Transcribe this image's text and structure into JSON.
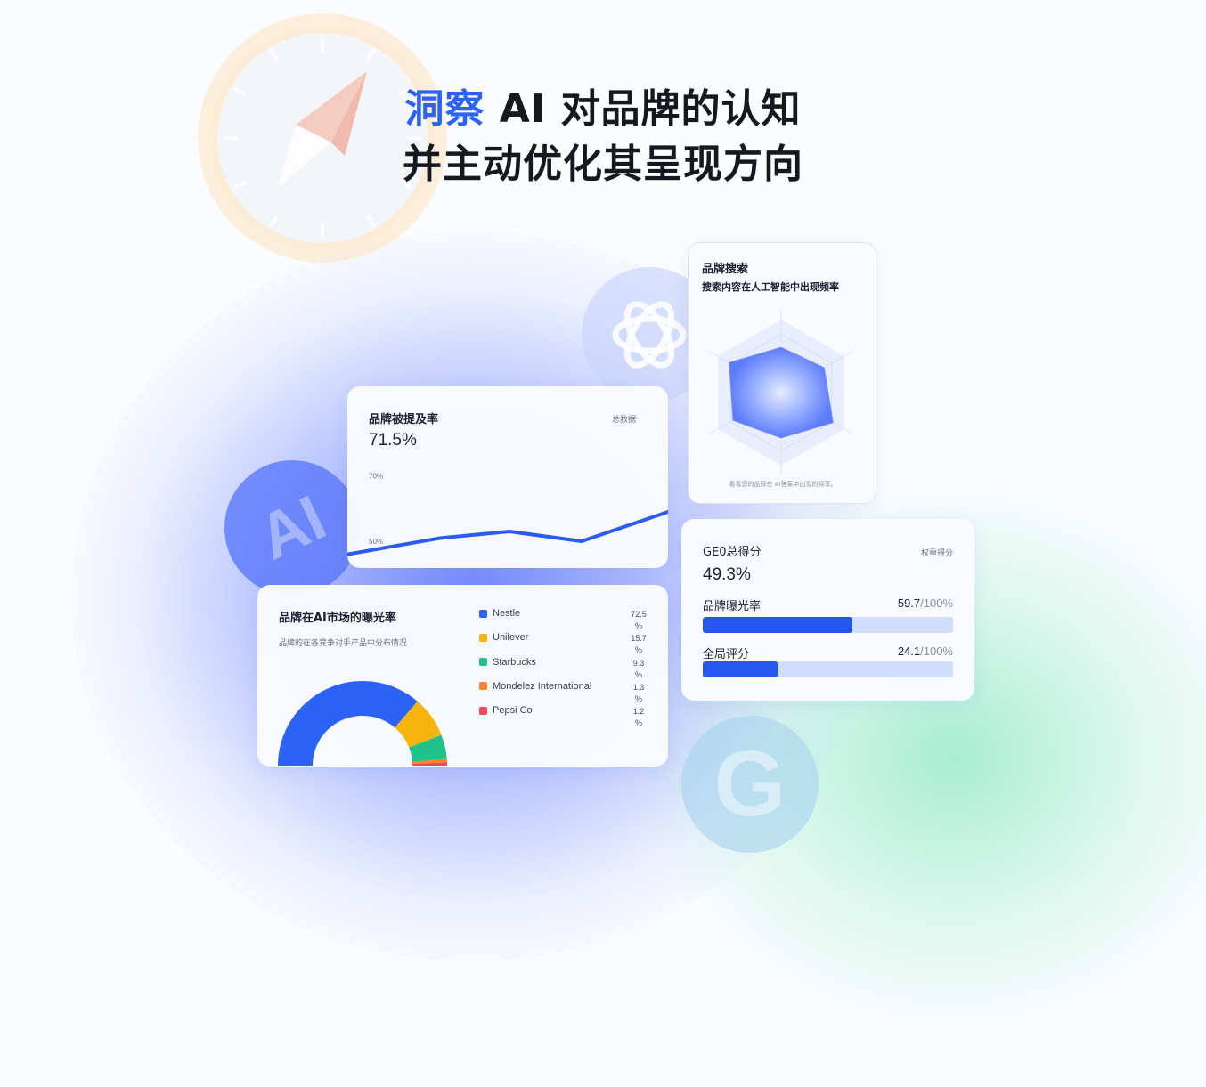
{
  "headline": {
    "accent": "洞察",
    "line1_rest": " AI 对品牌的认知",
    "line2": "并主动优化其呈现方向"
  },
  "icons": [
    "compass-icon",
    "openai-icon",
    "ai-icon",
    "google-icon"
  ],
  "mention_card": {
    "title": "品牌被提及率",
    "scope": "总数据",
    "value": "71.5%",
    "chart_data": {
      "type": "line",
      "x": [
        0,
        1,
        2,
        3,
        4
      ],
      "values": [
        46,
        51,
        53,
        50,
        59
      ],
      "ylim": [
        44,
        74
      ],
      "ytick_labels": [
        "70%",
        "50%"
      ],
      "ytick_values": [
        70,
        50
      ],
      "color": "#2b5cf0"
    }
  },
  "radar_card": {
    "title": "品牌搜索",
    "subtitle": "搜索内容在人工智能中出现频率",
    "footnote": "看看您的品牌在 AI答案中出现的频率。",
    "chart_data": {
      "type": "radar",
      "axes": 6,
      "values": [
        0.62,
        0.68,
        0.82,
        0.62,
        0.76,
        0.82
      ],
      "max": 1
    }
  },
  "donut_card": {
    "title": "品牌在AI市场的曝光率",
    "subtitle": "品牌的在各竞争对手产品中分布情况",
    "chart_data": {
      "type": "pie",
      "categories": [
        "Nestle",
        "Unilever",
        "Starbucks",
        "Mondelez International",
        "Pepsi Co"
      ],
      "values": [
        72.5,
        15.7,
        9.3,
        1.3,
        1.2
      ],
      "colors": [
        "#2b63f5",
        "#f5b40e",
        "#1fc28a",
        "#f5862a",
        "#f04a5a"
      ]
    },
    "legend": [
      {
        "name": "Nestle",
        "value": "72.5",
        "unit": "%"
      },
      {
        "name": "Unilever",
        "value": "15.7",
        "unit": "%"
      },
      {
        "name": "Starbucks",
        "value": "9.3",
        "unit": "%"
      },
      {
        "name": "Mondelez International",
        "value": "1.3",
        "unit": "%"
      },
      {
        "name": "Pepsi Co",
        "value": "1.2",
        "unit": "%"
      }
    ]
  },
  "score_card": {
    "title": "GE0总得分",
    "scope": "权重得分",
    "value": "49.3%",
    "bars": [
      {
        "label": "品牌曝光率",
        "value": "59.7",
        "max": "/100%",
        "fraction": 0.597
      },
      {
        "label": "全局评分",
        "value": "24.1",
        "max": "/100%",
        "fraction": 0.299
      }
    ]
  }
}
